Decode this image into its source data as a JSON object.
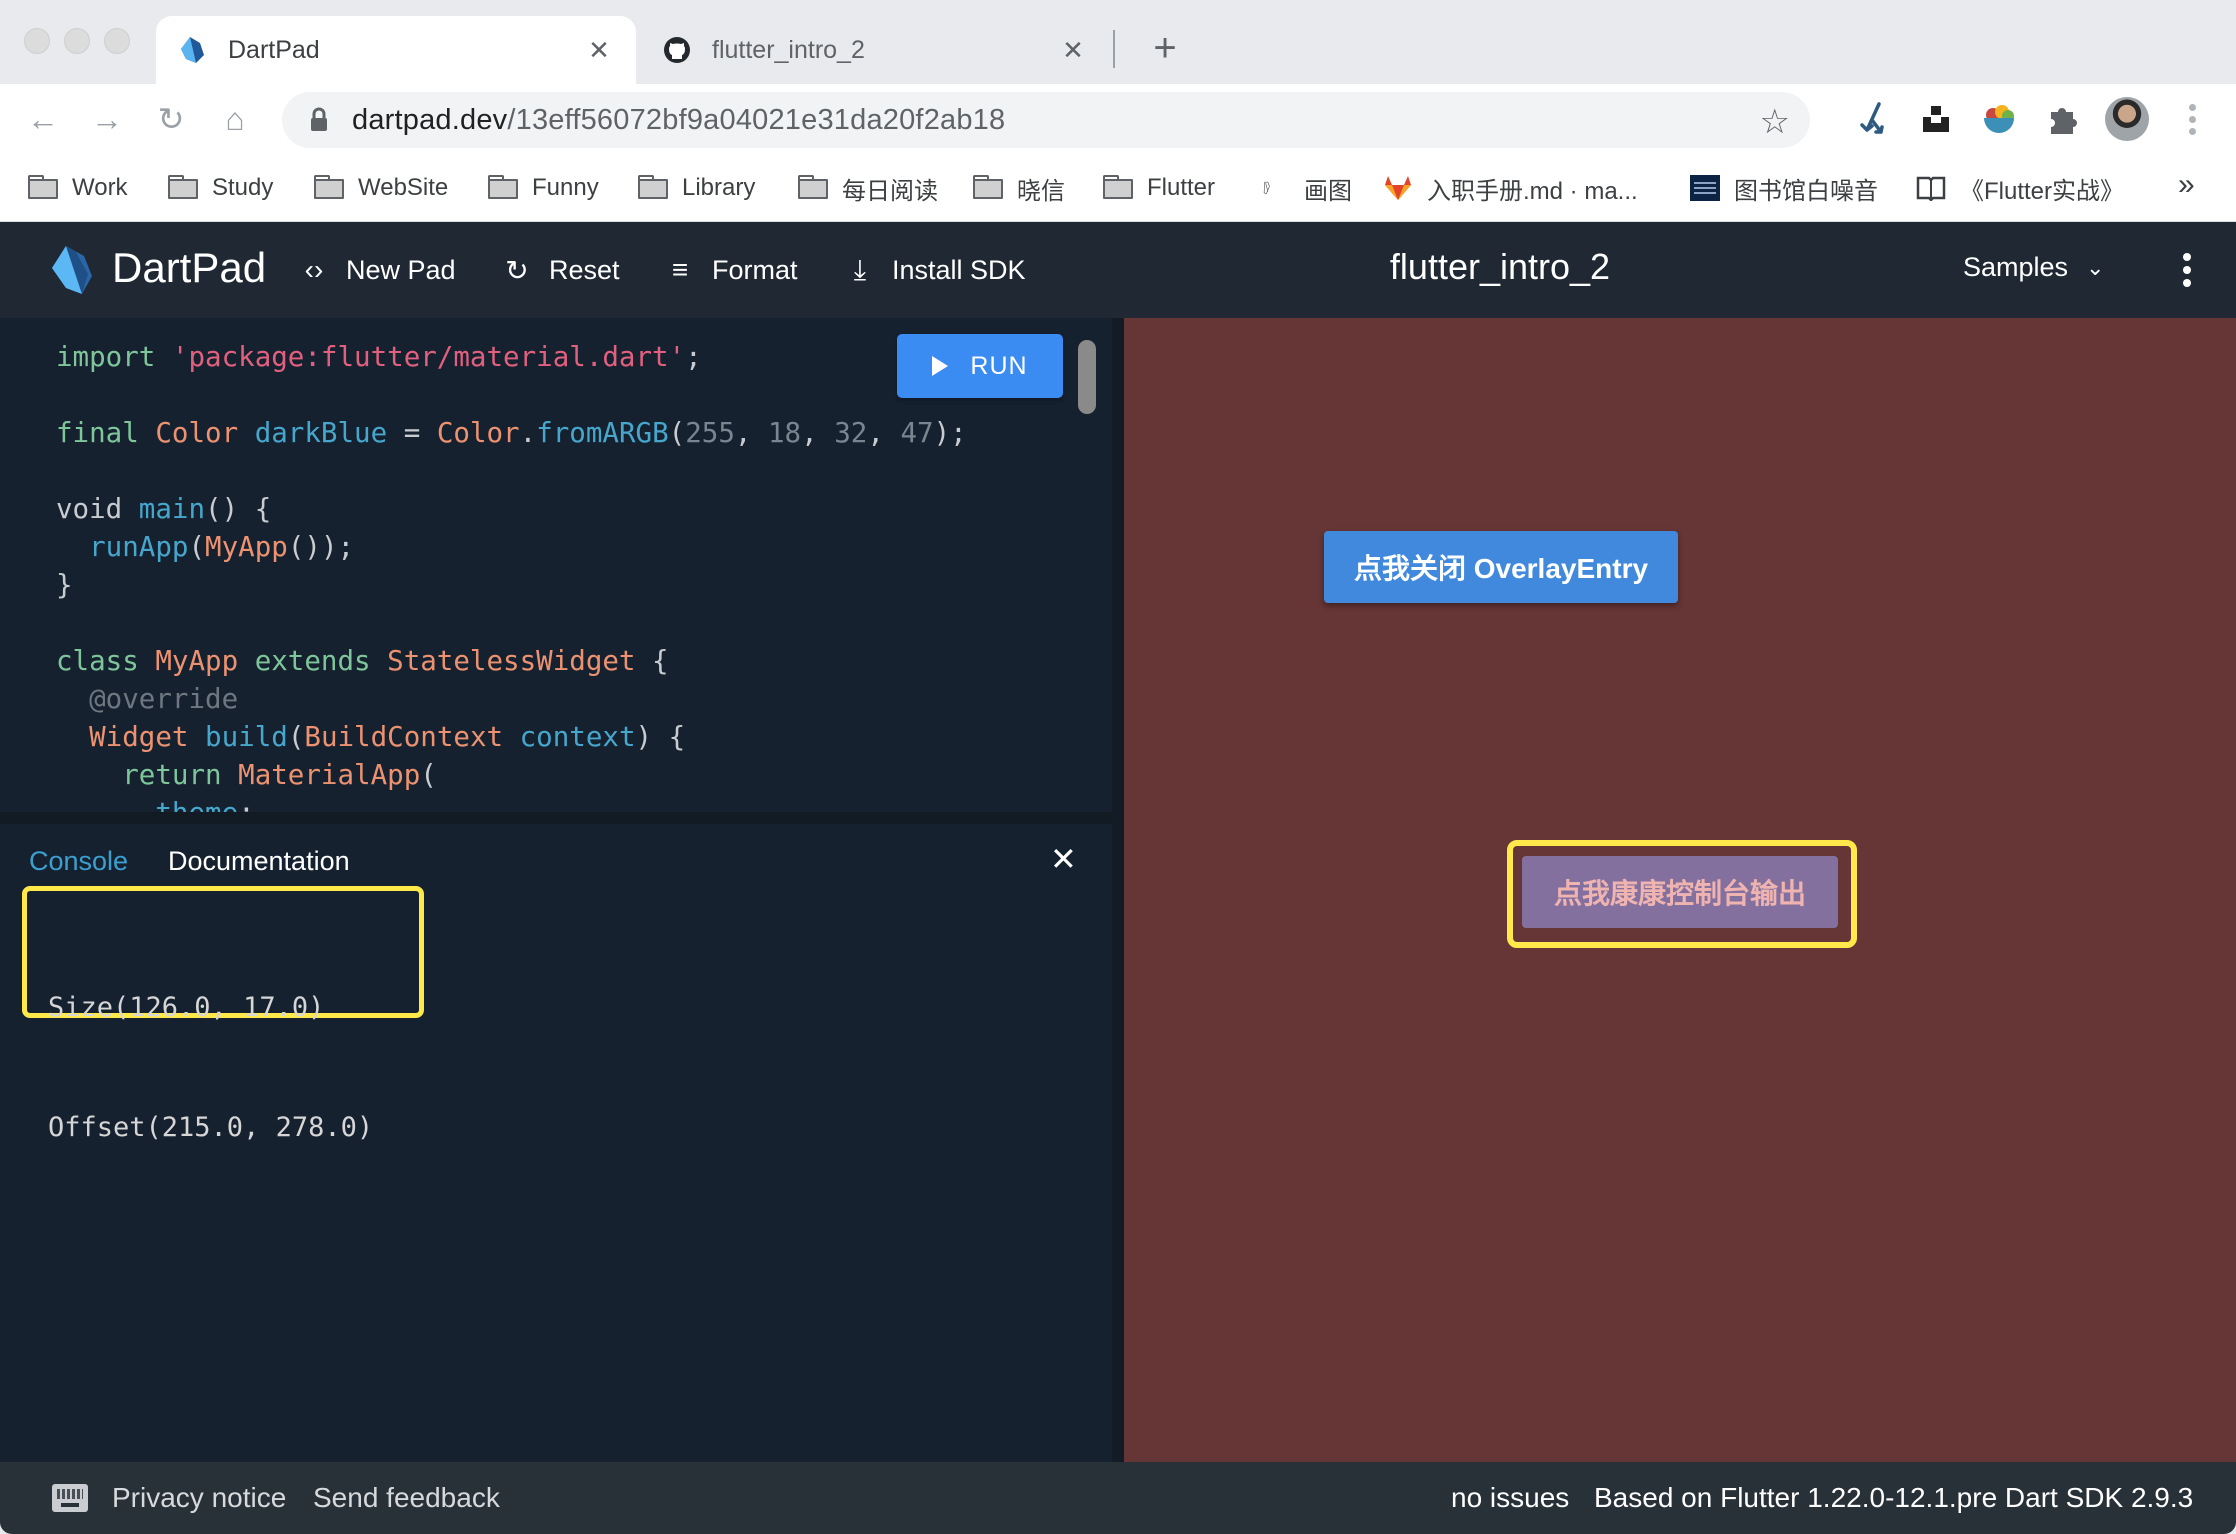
{
  "browser": {
    "tabs": [
      {
        "title": "DartPad",
        "icon": "dart-logo-icon",
        "active": true
      },
      {
        "title": "flutter_intro_2",
        "icon": "github-icon",
        "active": false
      }
    ],
    "close_glyph": "✕",
    "new_tab_glyph": "+",
    "url_host": "dartpad.dev",
    "url_path": "/13eff56072bf9a04021e31da20f2ab18",
    "nav": {
      "back": "←",
      "forward": "→",
      "reload": "↻",
      "home": "⌂"
    },
    "star_glyph": "☆",
    "bookmarks": [
      {
        "label": "Work",
        "icon": "folder-icon"
      },
      {
        "label": "Study",
        "icon": "folder-icon"
      },
      {
        "label": "WebSite",
        "icon": "folder-icon"
      },
      {
        "label": "Funny",
        "icon": "folder-icon"
      },
      {
        "label": "Library",
        "icon": "folder-icon"
      },
      {
        "label": "每日阅读",
        "icon": "folder-icon"
      },
      {
        "label": "晓信",
        "icon": "folder-icon"
      },
      {
        "label": "Flutter",
        "icon": "folder-icon"
      },
      {
        "label": "画图",
        "icon": "drawio-icon"
      },
      {
        "label": "入职手册.md · ma...",
        "icon": "gitlab-icon"
      },
      {
        "label": "图书馆白噪音",
        "icon": "library-noise-icon"
      },
      {
        "label": "《Flutter实战》",
        "icon": "book-icon"
      }
    ],
    "bookmarks_overflow": "»"
  },
  "dartpad": {
    "brand": "DartPad",
    "actions": [
      {
        "label": "New Pad",
        "glyph": "‹›"
      },
      {
        "label": "Reset",
        "glyph": "↻"
      },
      {
        "label": "Format",
        "glyph": "≡"
      },
      {
        "label": "Install SDK",
        "glyph": "⤓"
      }
    ],
    "pad_title": "flutter_intro_2",
    "samples_label": "Samples",
    "samples_chevron": "⌄",
    "run_label": "RUN",
    "code_lines": [
      [
        {
          "c": "k",
          "t": "import "
        },
        {
          "c": "s",
          "t": "'package:flutter/material.dart'"
        },
        {
          "c": "p",
          "t": ";"
        }
      ],
      [],
      [
        {
          "c": "k",
          "t": "final "
        },
        {
          "c": "t",
          "t": "Color "
        },
        {
          "c": "f",
          "t": "darkBlue "
        },
        {
          "c": "p",
          "t": "= "
        },
        {
          "c": "t",
          "t": "Color"
        },
        {
          "c": "p",
          "t": "."
        },
        {
          "c": "f",
          "t": "fromARGB"
        },
        {
          "c": "p",
          "t": "("
        },
        {
          "c": "n",
          "t": "255"
        },
        {
          "c": "p",
          "t": ", "
        },
        {
          "c": "n",
          "t": "18"
        },
        {
          "c": "p",
          "t": ", "
        },
        {
          "c": "n",
          "t": "32"
        },
        {
          "c": "p",
          "t": ", "
        },
        {
          "c": "n",
          "t": "47"
        },
        {
          "c": "p",
          "t": ");"
        }
      ],
      [],
      [
        {
          "c": "p",
          "t": "void "
        },
        {
          "c": "f",
          "t": "main"
        },
        {
          "c": "p",
          "t": "() {"
        }
      ],
      [
        {
          "c": "p",
          "t": "  "
        },
        {
          "c": "f",
          "t": "runApp"
        },
        {
          "c": "p",
          "t": "("
        },
        {
          "c": "t",
          "t": "MyApp"
        },
        {
          "c": "p",
          "t": "());"
        }
      ],
      [
        {
          "c": "p",
          "t": "}"
        }
      ],
      [],
      [
        {
          "c": "k",
          "t": "class "
        },
        {
          "c": "t",
          "t": "MyApp "
        },
        {
          "c": "k",
          "t": "extends "
        },
        {
          "c": "t",
          "t": "StatelessWidget "
        },
        {
          "c": "p",
          "t": "{"
        }
      ],
      [
        {
          "c": "m",
          "t": "  @override"
        }
      ],
      [
        {
          "c": "p",
          "t": "  "
        },
        {
          "c": "t",
          "t": "Widget "
        },
        {
          "c": "f",
          "t": "build"
        },
        {
          "c": "p",
          "t": "("
        },
        {
          "c": "t",
          "t": "BuildContext "
        },
        {
          "c": "f",
          "t": "context"
        },
        {
          "c": "p",
          "t": ") {"
        }
      ],
      [
        {
          "c": "p",
          "t": "    "
        },
        {
          "c": "k",
          "t": "return "
        },
        {
          "c": "t",
          "t": "MaterialApp"
        },
        {
          "c": "p",
          "t": "("
        }
      ],
      [
        {
          "c": "p",
          "t": "      "
        },
        {
          "c": "f",
          "t": "theme"
        },
        {
          "c": "p",
          "t": ":"
        }
      ]
    ],
    "console": {
      "tabs": [
        {
          "label": "Console",
          "active": true
        },
        {
          "label": "Documentation",
          "active": false
        }
      ],
      "close_glyph": "✕",
      "output_lines": [
        "Size(126.0, 17.0)",
        "Offset(215.0, 278.0)"
      ]
    },
    "preview": {
      "background": "#663535",
      "close_overlay_button": "点我关闭 OverlayEntry",
      "console_output_button": "点我康康控制台输出"
    },
    "footer": {
      "privacy": "Privacy notice",
      "feedback": "Send feedback",
      "issues": "no issues",
      "version": "Based on Flutter 1.22.0-12.1.pre Dart SDK 2.9.3"
    }
  },
  "colors": {
    "run_button": "#3b8cf2",
    "highlight_frame": "#ffe94a",
    "console_tab_active": "#3ba0d0",
    "overlay_button": "#4189dd",
    "console_button": "#83709f",
    "console_button_text": "#f0b4b0"
  }
}
